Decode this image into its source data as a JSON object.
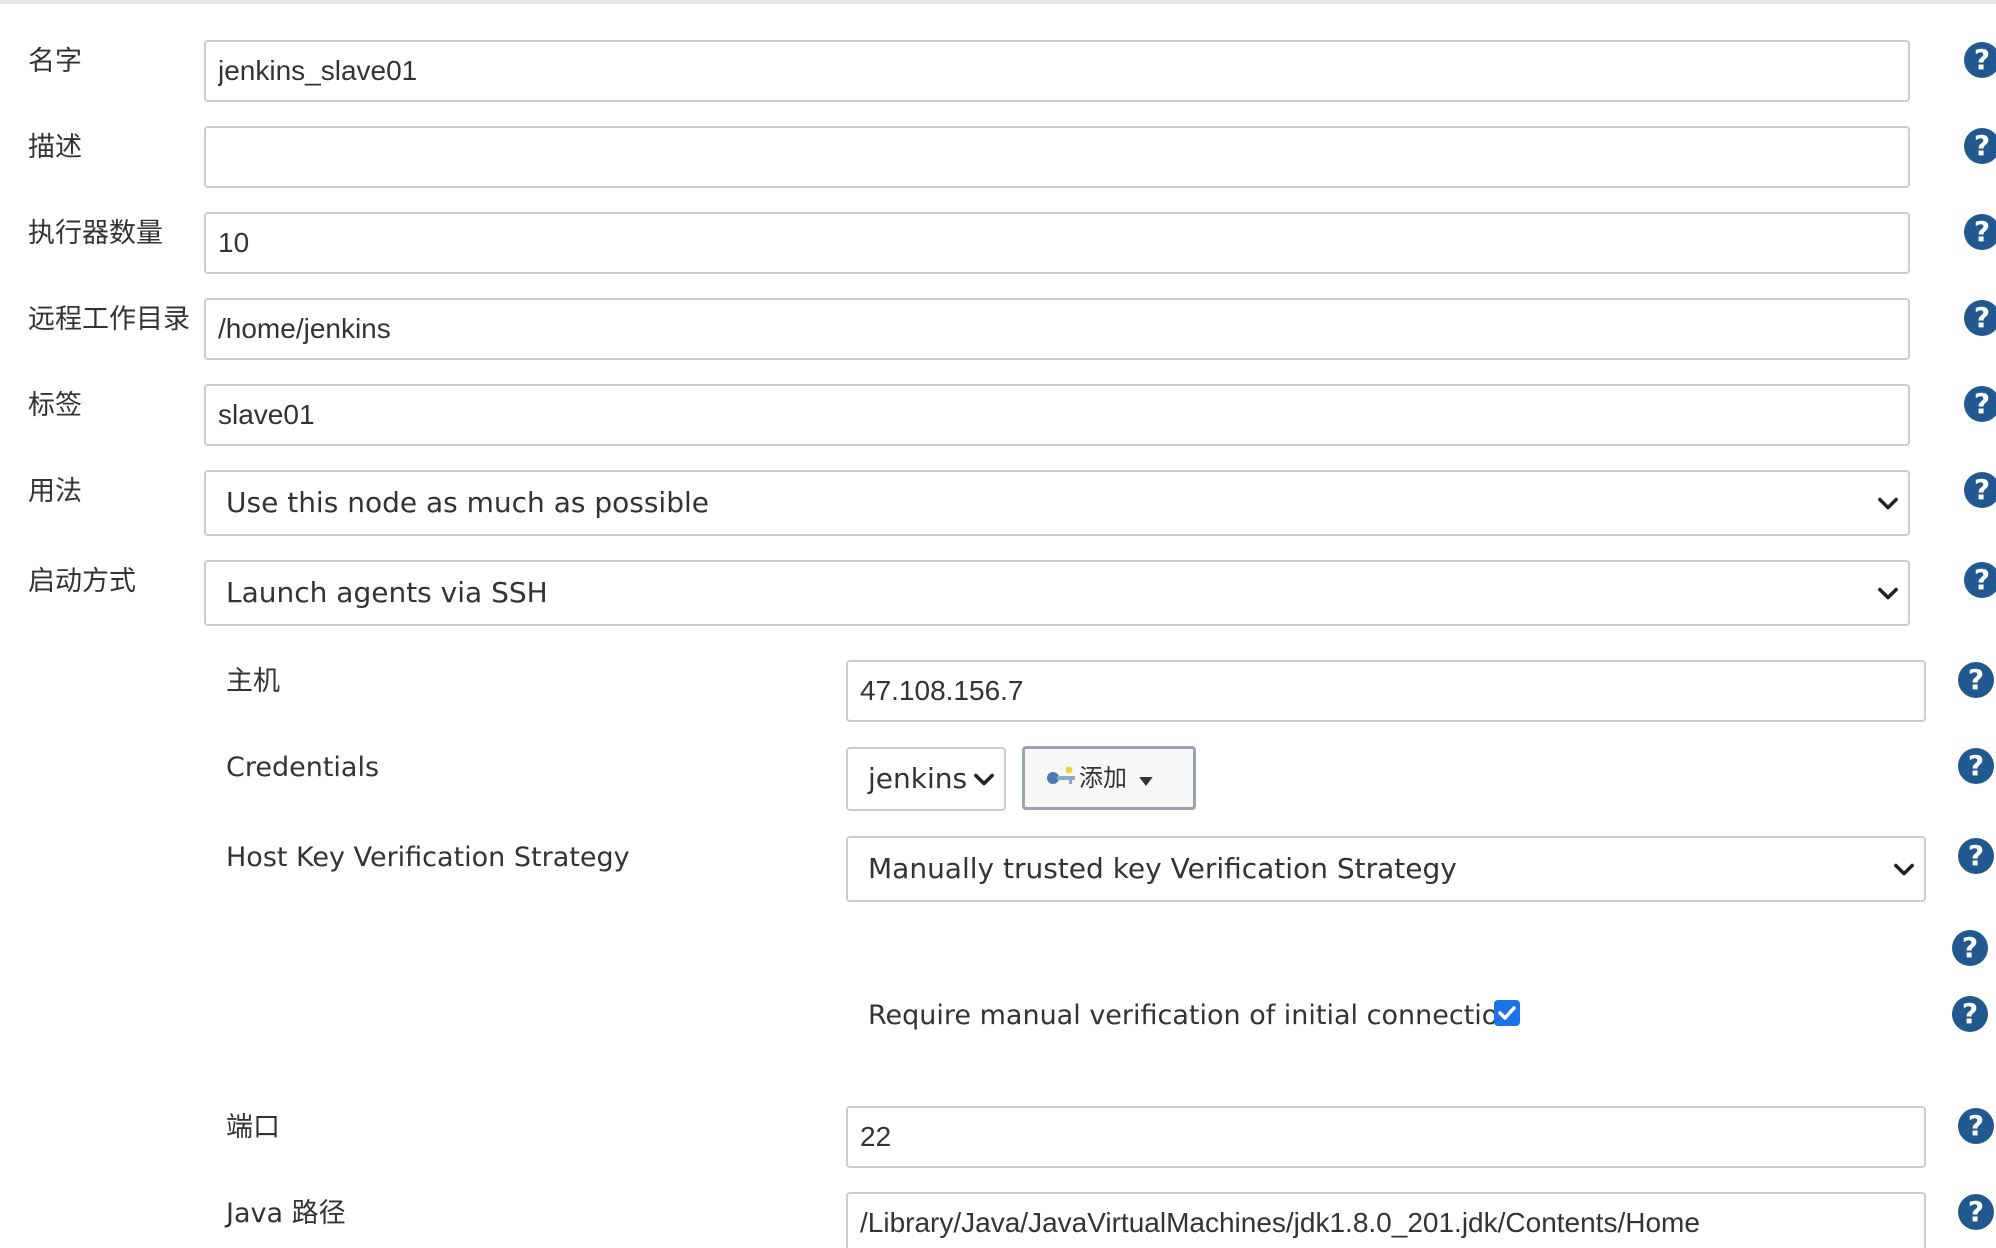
{
  "form": {
    "name": {
      "label": "名字",
      "value": "jenkins_slave01"
    },
    "description": {
      "label": "描述",
      "value": ""
    },
    "executors": {
      "label": "执行器数量",
      "value": "10"
    },
    "remote_root": {
      "label": "远程工作目录",
      "value": "/home/jenkins"
    },
    "labels": {
      "label": "标签",
      "value": "slave01"
    },
    "usage": {
      "label": "用法",
      "selected": "Use this node as much as possible"
    },
    "launch_method": {
      "label": "启动方式",
      "selected": "Launch agents via SSH"
    }
  },
  "ssh": {
    "host": {
      "label": "主机",
      "value": "47.108.156.7"
    },
    "credentials": {
      "label": "Credentials",
      "selected": "jenkins",
      "add_label": "添加"
    },
    "host_key_strategy": {
      "label": "Host Key Verification Strategy",
      "selected": "Manually trusted key Verification Strategy"
    },
    "manual_verification": {
      "label": "Require manual verification of initial connection",
      "checked": true
    },
    "port": {
      "label": "端口",
      "value": "22"
    },
    "java_path": {
      "label": "Java 路径",
      "value": "/Library/Java/JavaVirtualMachines/jdk1.8.0_201.jdk/Contents/Home"
    }
  },
  "help_symbol": "?",
  "colors": {
    "help_icon": "#20588f",
    "checkbox": "#1a73e8",
    "border": "#cccccc",
    "text": "#333333"
  },
  "icons": {
    "help": "help-icon",
    "key": "key-icon",
    "caret": "caret-down-icon",
    "chevron": "chevron-down-icon",
    "check": "checkmark-icon"
  }
}
